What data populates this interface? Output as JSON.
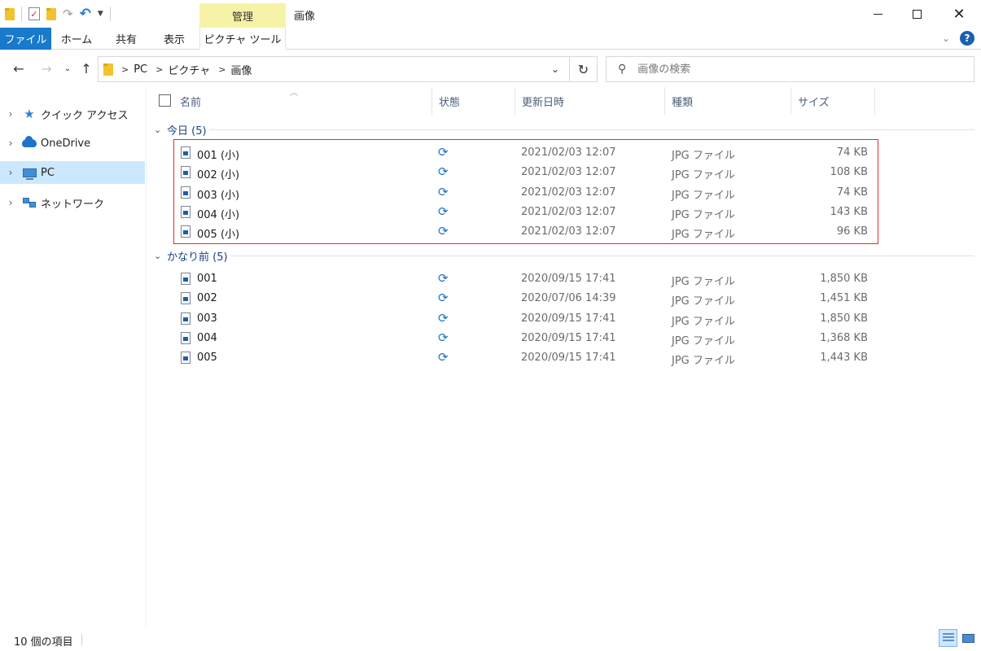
{
  "window": {
    "title": "画像",
    "manage_tab": "管理",
    "minimize_glyph": "",
    "maximize_glyph": "",
    "close_glyph": "✕"
  },
  "qat": {
    "icons": [
      "folder-icon",
      "properties-check-icon",
      "new-folder-icon",
      "redo-icon",
      "undo-icon",
      "customize-dropdown-icon"
    ]
  },
  "ribbon": {
    "tabs": [
      "ファイル",
      "ホーム",
      "共有",
      "表示",
      "ピクチャ ツール"
    ],
    "help": "?"
  },
  "address": {
    "crumbs": [
      "PC",
      "ピクチャ",
      "画像"
    ],
    "separator": ">"
  },
  "search": {
    "placeholder": "画像の検索"
  },
  "nav": {
    "items": [
      {
        "label": "クイック アクセス",
        "icon": "star-icon"
      },
      {
        "label": "OneDrive",
        "icon": "cloud-icon"
      },
      {
        "label": "PC",
        "icon": "pc-icon",
        "selected": true
      },
      {
        "label": "ネットワーク",
        "icon": "network-icon"
      }
    ]
  },
  "columns": {
    "name": "名前",
    "state": "状態",
    "date": "更新日時",
    "type": "種類",
    "size": "サイズ"
  },
  "groups": [
    {
      "title": "今日 (5)",
      "files": [
        {
          "name": "001 (小)",
          "date": "2021/02/03 12:07",
          "type": "JPG ファイル",
          "size": "74 KB"
        },
        {
          "name": "002 (小)",
          "date": "2021/02/03 12:07",
          "type": "JPG ファイル",
          "size": "108 KB"
        },
        {
          "name": "003 (小)",
          "date": "2021/02/03 12:07",
          "type": "JPG ファイル",
          "size": "74 KB"
        },
        {
          "name": "004 (小)",
          "date": "2021/02/03 12:07",
          "type": "JPG ファイル",
          "size": "143 KB"
        },
        {
          "name": "005 (小)",
          "date": "2021/02/03 12:07",
          "type": "JPG ファイル",
          "size": "96 KB"
        }
      ]
    },
    {
      "title": "かなり前 (5)",
      "files": [
        {
          "name": "001",
          "date": "2020/09/15 17:41",
          "type": "JPG ファイル",
          "size": "1,850 KB"
        },
        {
          "name": "002",
          "date": "2020/07/06 14:39",
          "type": "JPG ファイル",
          "size": "1,451 KB"
        },
        {
          "name": "003",
          "date": "2020/09/15 17:41",
          "type": "JPG ファイル",
          "size": "1,850 KB"
        },
        {
          "name": "004",
          "date": "2020/09/15 17:41",
          "type": "JPG ファイル",
          "size": "1,368 KB"
        },
        {
          "name": "005",
          "date": "2020/09/15 17:41",
          "type": "JPG ファイル",
          "size": "1,443 KB"
        }
      ]
    }
  ],
  "status": {
    "count": "10 個の項目"
  },
  "colors": {
    "accent": "#1979ca",
    "manage_tab_bg": "#f7f3a6",
    "selection": "#cce8ff",
    "highlight_border": "#e0302a",
    "sync_icon": "#1a73c9"
  }
}
